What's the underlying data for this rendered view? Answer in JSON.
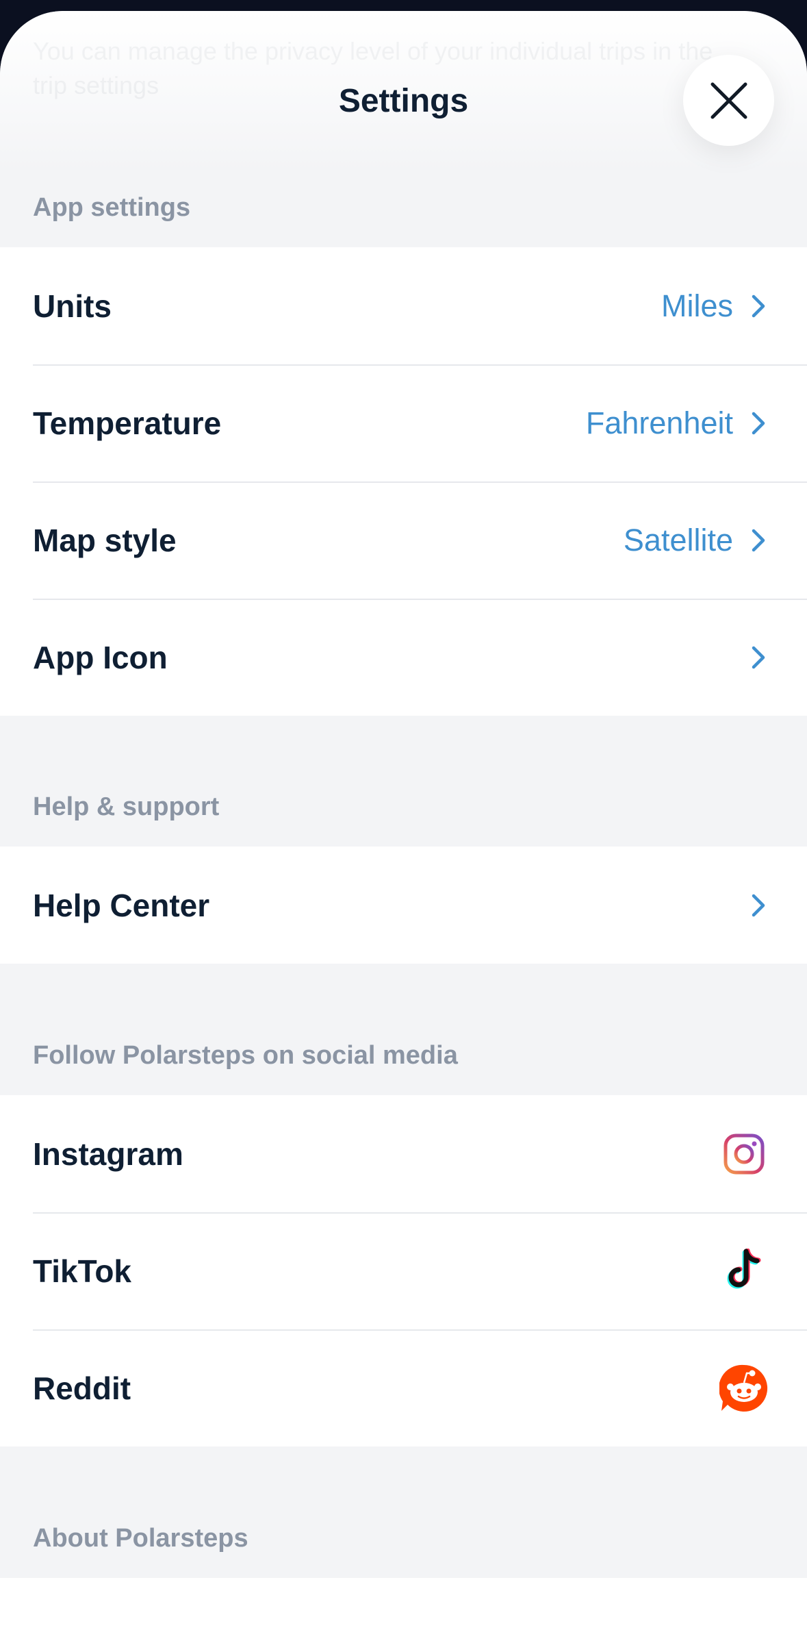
{
  "sheet": {
    "title": "Settings",
    "background_hint": "You can manage the privacy level of your individual trips in the trip settings"
  },
  "sections": {
    "app_settings": {
      "label": "App settings",
      "rows": [
        {
          "label": "Units",
          "value": "Miles"
        },
        {
          "label": "Temperature",
          "value": "Fahrenheit"
        },
        {
          "label": "Map style",
          "value": "Satellite"
        },
        {
          "label": "App Icon",
          "value": ""
        }
      ]
    },
    "help_support": {
      "label": "Help & support",
      "rows": [
        {
          "label": "Help Center"
        }
      ]
    },
    "social": {
      "label": "Follow Polarsteps on social media",
      "rows": [
        {
          "label": "Instagram",
          "icon": "instagram-icon"
        },
        {
          "label": "TikTok",
          "icon": "tiktok-icon"
        },
        {
          "label": "Reddit",
          "icon": "reddit-icon"
        }
      ]
    },
    "about": {
      "label": "About Polarsteps"
    }
  },
  "colors": {
    "accent": "#3e8fcf",
    "label": "#0f1f33",
    "section_label": "#8a94a3",
    "reddit": "#ff4500"
  }
}
